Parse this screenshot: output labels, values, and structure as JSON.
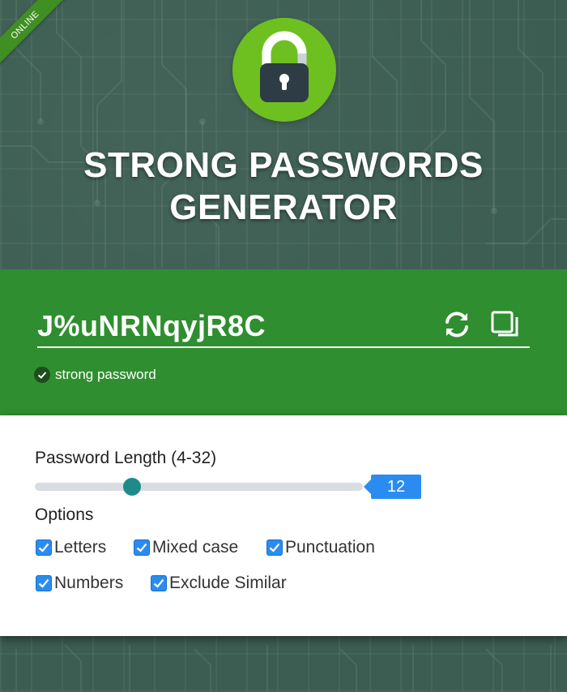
{
  "badge": {
    "status": "ONLINE"
  },
  "header": {
    "title_line1": "STRONG PASSWORDS",
    "title_line2": "GENERATOR"
  },
  "password": {
    "value": "J%uNRNqyjR8C",
    "strength": "strong password"
  },
  "length": {
    "label": "Password Length (4-32)",
    "value": "12",
    "min": 4,
    "max": 32,
    "current": 12
  },
  "options": {
    "label": "Options",
    "items": [
      {
        "label": "Letters",
        "checked": true
      },
      {
        "label": "Mixed case",
        "checked": true
      },
      {
        "label": "Punctuation",
        "checked": true
      },
      {
        "label": "Numbers",
        "checked": true
      },
      {
        "label": "Exclude Similar",
        "checked": true
      }
    ]
  },
  "colors": {
    "background": "#3c5d52",
    "password_band": "#2f8e2f",
    "logo_circle": "#6ec021",
    "accent_blue": "#2a8cf0",
    "slider_thumb": "#1f8a8a"
  },
  "icons": [
    "padlock-icon",
    "refresh-icon",
    "copy-icon",
    "check-icon",
    "checkbox-icon"
  ]
}
